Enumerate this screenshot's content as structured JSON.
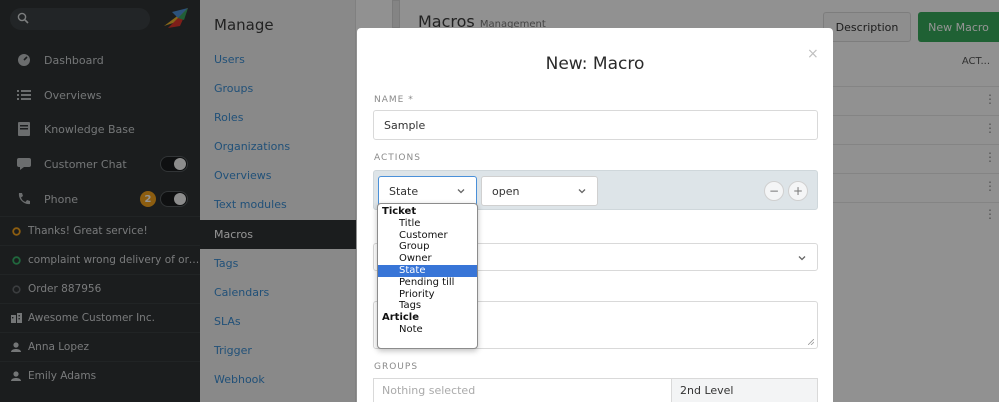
{
  "nav": {
    "items": [
      {
        "label": "Dashboard",
        "icon": "dashboard-icon"
      },
      {
        "label": "Overviews",
        "icon": "list-icon"
      },
      {
        "label": "Knowledge Base",
        "icon": "book-icon"
      },
      {
        "label": "Customer Chat",
        "icon": "chat-icon"
      },
      {
        "label": "Phone",
        "icon": "phone-icon",
        "badge": "2"
      }
    ],
    "tasks": [
      {
        "label": "Thanks! Great service!",
        "icon": "ticket-open-icon",
        "color": "#f2a11d"
      },
      {
        "label": "complaint wrong delivery of ord...",
        "icon": "ticket-open-icon",
        "color": "#38b26a"
      },
      {
        "label": "Order 887956",
        "icon": "ticket-closed-icon",
        "color": "#666a6d"
      },
      {
        "label": "Awesome Customer Inc.",
        "icon": "organization-icon",
        "color": "#c8ccce"
      },
      {
        "label": "Anna Lopez",
        "icon": "user-icon",
        "color": "#c8ccce"
      },
      {
        "label": "Emily Adams",
        "icon": "user-icon",
        "color": "#c8ccce"
      }
    ]
  },
  "manage": {
    "title": "Manage",
    "items": [
      "Users",
      "Groups",
      "Roles",
      "Organizations",
      "Overviews",
      "Text modules",
      "Macros",
      "Tags",
      "Calendars",
      "SLAs",
      "Trigger",
      "Webhook"
    ],
    "active": "Macros"
  },
  "main": {
    "title": "Macros",
    "title_sub": "Management",
    "description_button": "Description",
    "new_button": "New Macro",
    "column_header": "ACT..."
  },
  "modal": {
    "title": "New: Macro",
    "close": "×",
    "name_label": "NAME *",
    "name_value": "Sample",
    "actions_label": "ACTIONS",
    "attribute_select": "State",
    "value_select": "open",
    "remove_button": "−",
    "add_button": "+",
    "groups_label": "GROUPS",
    "groups_placeholder": "Nothing selected",
    "groups_selected": "2nd Level"
  },
  "dropdown": {
    "groups": [
      {
        "label": "Ticket",
        "options": [
          "Title",
          "Customer",
          "Group",
          "Owner",
          "State",
          "Pending till",
          "Priority",
          "Tags"
        ]
      },
      {
        "label": "Article",
        "options": [
          "Note"
        ]
      }
    ],
    "selected": "State"
  },
  "colors": {
    "nav_bg": "#2f3234",
    "accent_green": "#36a85a",
    "link_blue": "#3a8bcf",
    "selection_blue": "#3875d7"
  }
}
